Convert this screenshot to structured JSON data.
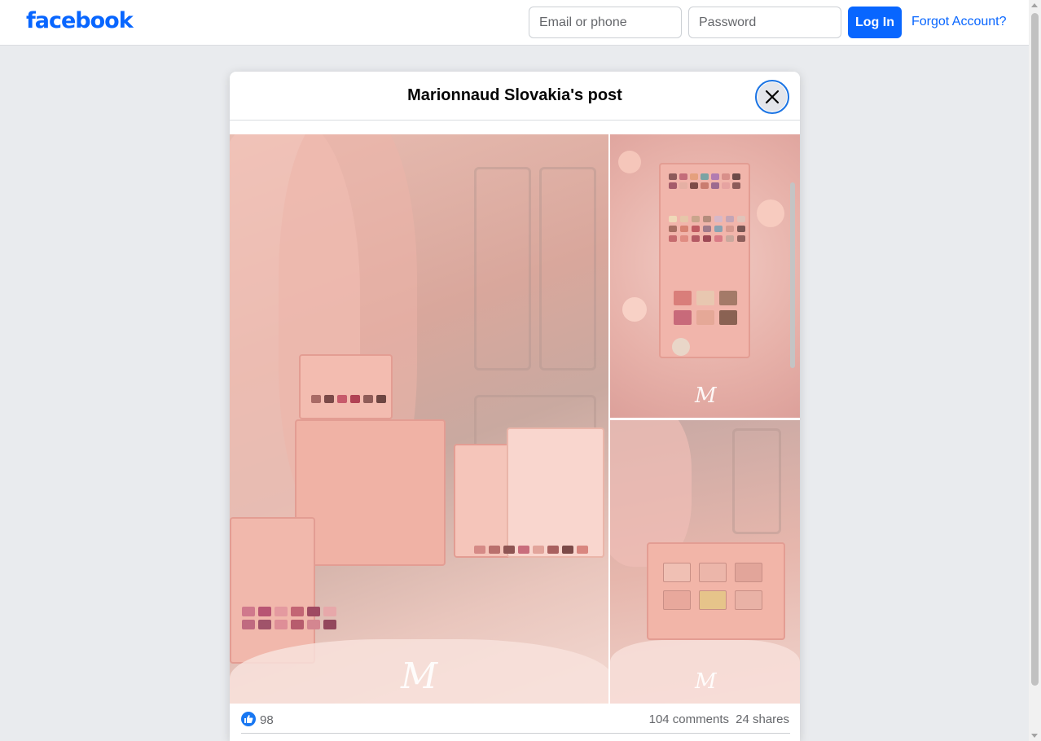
{
  "header": {
    "logo_text": "facebook",
    "email_placeholder": "Email or phone",
    "password_placeholder": "Password",
    "login_label": "Log In",
    "forgot_label": "Forgot Account?"
  },
  "modal": {
    "title": "Marionnaud Slovakia's post",
    "close_icon": "close-icon"
  },
  "photos": [
    {
      "name": "main-photo",
      "watermark": "M"
    },
    {
      "name": "top-right-photo",
      "watermark": "M"
    },
    {
      "name": "bottom-right-photo",
      "watermark": "M"
    }
  ],
  "engagement": {
    "like_count": "98",
    "comments": "104 comments",
    "shares": "24 shares"
  },
  "colors": {
    "brand": "#0866ff",
    "like": "#1877f2"
  }
}
